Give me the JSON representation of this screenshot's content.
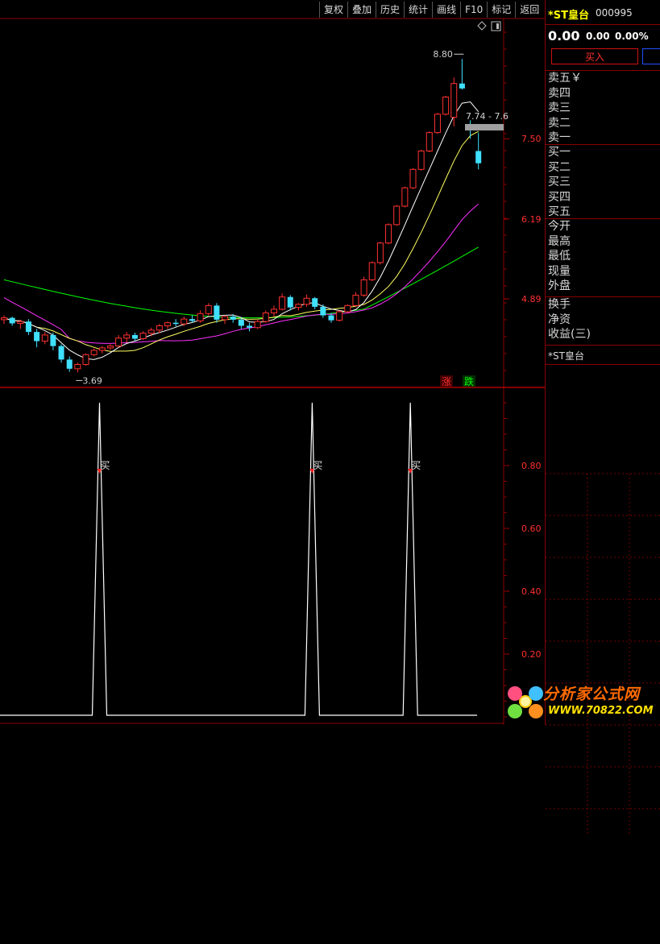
{
  "toolbar": {
    "items": [
      "复权",
      "叠加",
      "历史",
      "统计",
      "画线",
      "F10",
      "标记",
      "返回"
    ]
  },
  "chart_data": [
    {
      "type": "candlestick",
      "axis_labels": [
        "7.50",
        "6.19",
        "4.89"
      ],
      "y_ticks": [
        7.5,
        6.19,
        4.89
      ],
      "annotations": {
        "high": "8.80",
        "low": "3.69",
        "range_tag": "7.74 - 7.6"
      },
      "legend": {
        "up": "涨",
        "down": "跌"
      },
      "colors": {
        "up": "#ff3030",
        "down": "#40e0ff",
        "ma5": "#ffffff",
        "ma10": "#ffff60",
        "ma20": "#ff30ff",
        "ma60": "#00ff00"
      },
      "candles": [
        [
          4.55,
          4.62,
          4.48,
          4.58
        ],
        [
          4.58,
          4.6,
          4.45,
          4.49
        ],
        [
          4.49,
          4.55,
          4.4,
          4.52
        ],
        [
          4.52,
          4.56,
          4.3,
          4.35
        ],
        [
          4.35,
          4.4,
          4.1,
          4.2
        ],
        [
          4.2,
          4.35,
          4.15,
          4.3
        ],
        [
          4.3,
          4.34,
          4.05,
          4.12
        ],
        [
          4.12,
          4.15,
          3.85,
          3.9
        ],
        [
          3.9,
          3.95,
          3.7,
          3.75
        ],
        [
          3.75,
          3.85,
          3.69,
          3.82
        ],
        [
          3.82,
          4.0,
          3.8,
          3.98
        ],
        [
          3.98,
          4.08,
          3.95,
          4.05
        ],
        [
          4.05,
          4.12,
          4.0,
          4.09
        ],
        [
          4.09,
          4.15,
          4.06,
          4.12
        ],
        [
          4.12,
          4.3,
          4.1,
          4.25
        ],
        [
          4.25,
          4.35,
          4.18,
          4.3
        ],
        [
          4.3,
          4.34,
          4.2,
          4.24
        ],
        [
          4.24,
          4.36,
          4.22,
          4.33
        ],
        [
          4.33,
          4.42,
          4.28,
          4.38
        ],
        [
          4.38,
          4.48,
          4.33,
          4.45
        ],
        [
          4.45,
          4.52,
          4.4,
          4.5
        ],
        [
          4.5,
          4.56,
          4.44,
          4.48
        ],
        [
          4.48,
          4.6,
          4.45,
          4.56
        ],
        [
          4.56,
          4.62,
          4.5,
          4.53
        ],
        [
          4.53,
          4.7,
          4.5,
          4.65
        ],
        [
          4.65,
          4.82,
          4.62,
          4.78
        ],
        [
          4.78,
          4.82,
          4.5,
          4.55
        ],
        [
          4.55,
          4.62,
          4.48,
          4.6
        ],
        [
          4.6,
          4.64,
          4.5,
          4.55
        ],
        [
          4.55,
          4.58,
          4.4,
          4.45
        ],
        [
          4.45,
          4.5,
          4.36,
          4.42
        ],
        [
          4.42,
          4.55,
          4.4,
          4.52
        ],
        [
          4.52,
          4.7,
          4.5,
          4.66
        ],
        [
          4.66,
          4.78,
          4.6,
          4.72
        ],
        [
          4.72,
          4.98,
          4.7,
          4.92
        ],
        [
          4.92,
          4.95,
          4.7,
          4.75
        ],
        [
          4.75,
          4.82,
          4.7,
          4.8
        ],
        [
          4.8,
          4.96,
          4.76,
          4.9
        ],
        [
          4.9,
          4.92,
          4.72,
          4.76
        ],
        [
          4.76,
          4.8,
          4.58,
          4.62
        ],
        [
          4.62,
          4.66,
          4.5,
          4.54
        ],
        [
          4.54,
          4.7,
          4.52,
          4.68
        ],
        [
          4.68,
          4.8,
          4.66,
          4.78
        ],
        [
          4.78,
          5.0,
          4.76,
          4.95
        ],
        [
          4.95,
          5.25,
          4.92,
          5.2
        ],
        [
          5.2,
          5.5,
          5.18,
          5.48
        ],
        [
          5.48,
          5.82,
          5.45,
          5.8
        ],
        [
          5.8,
          6.12,
          5.78,
          6.1
        ],
        [
          6.1,
          6.42,
          6.08,
          6.4
        ],
        [
          6.4,
          6.72,
          6.38,
          6.7
        ],
        [
          6.7,
          7.02,
          6.68,
          7.0
        ],
        [
          7.0,
          7.32,
          6.98,
          7.3
        ],
        [
          7.3,
          7.62,
          7.28,
          7.6
        ],
        [
          7.6,
          7.92,
          7.58,
          7.9
        ],
        [
          7.9,
          8.2,
          7.88,
          8.18
        ],
        [
          7.85,
          8.5,
          7.7,
          8.4
        ],
        [
          8.4,
          8.8,
          8.3,
          8.32
        ],
        [
          7.74,
          7.8,
          7.5,
          7.7
        ],
        [
          7.3,
          7.6,
          7.0,
          7.1
        ]
      ]
    },
    {
      "type": "line",
      "axis_labels": [
        "0.80",
        "0.60",
        "0.40",
        "0.20"
      ],
      "y_ticks": [
        0.8,
        0.6,
        0.4,
        0.2
      ],
      "ylim": [
        0,
        1.0
      ],
      "signal_label": "买",
      "signals": [
        10,
        36,
        48
      ]
    }
  ],
  "quote": {
    "name": "*ST皇台",
    "code": "000995",
    "price": "0.00",
    "change": "0.00",
    "change_pct": "0.00%",
    "buy_button": "买入"
  },
  "sections": [
    [
      "卖五￥",
      "卖四",
      "卖三",
      "卖二",
      "卖一"
    ],
    [
      "买一",
      "买二",
      "买三",
      "买四",
      "买五"
    ],
    [
      "今开",
      "最高",
      "最低",
      "现量",
      "外盘"
    ],
    [
      "换手",
      "净资",
      "收益(三)"
    ]
  ],
  "bottom_name": "*ST皇台",
  "logo": {
    "text1": "分析家公式网",
    "text2": "WWW.70822.COM"
  }
}
